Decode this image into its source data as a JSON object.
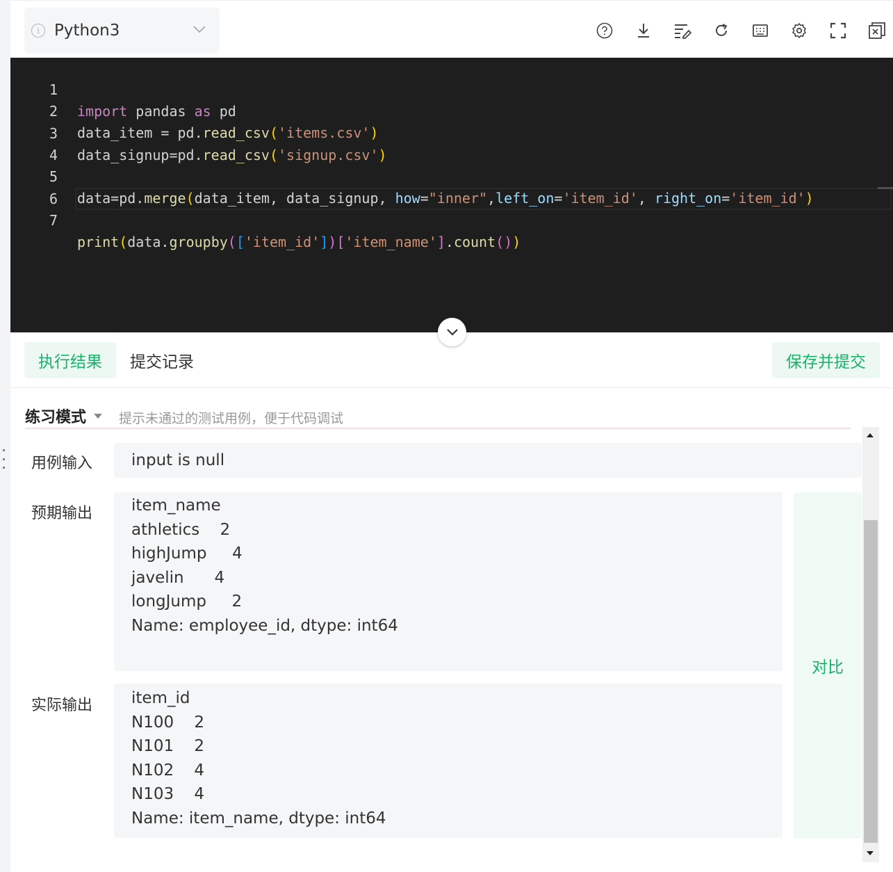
{
  "toolbar": {
    "language": "Python3",
    "icons": [
      "help-icon",
      "download-icon",
      "format-icon",
      "refresh-icon",
      "keyboard-icon",
      "settings-icon",
      "fullscreen-icon",
      "close-window-icon"
    ]
  },
  "editor": {
    "line_numbers": [
      "1",
      "2",
      "3",
      "4",
      "5",
      "6",
      "7"
    ],
    "lines": [
      "import pandas as pd",
      "data_item = pd.read_csv('items.csv')",
      "data_signup=pd.read_csv('signup.csv')",
      "",
      "data=pd.merge(data_item, data_signup, how=\"inner\",left_on='item_id', right_on='item_id')",
      "",
      "print(data.groupby(['item_id'])['item_name'].count())"
    ],
    "syntax_colors": {
      "keyword": "#c586c0",
      "string": "#ce9178",
      "function": "#dcdcaa",
      "param": "#9cdcfe",
      "text": "#d4d4d4",
      "background": "#1e1e1e"
    }
  },
  "tabs": {
    "result": "执行结果",
    "history": "提交记录",
    "save_submit": "保存并提交"
  },
  "mode": {
    "label": "练习模式",
    "hint": "提示未通过的测试用例，便于代码调试"
  },
  "testcase": {
    "input_label": "用例输入",
    "input_value": "input is null",
    "expected_label": "预期输出",
    "expected_lines": [
      "item_name",
      "athletics    2",
      "highJump     4",
      "javelin      4",
      "longJump     2",
      "Name: employee_id, dtype: int64"
    ],
    "actual_label": "实际输出",
    "actual_lines": [
      "item_id",
      "N100    2",
      "N101    2",
      "N102    4",
      "N103    4",
      "Name: item_name, dtype: int64"
    ],
    "compare_label": "对比"
  },
  "colors": {
    "accent": "#19b26b",
    "accent_bg": "#edf8f3"
  }
}
